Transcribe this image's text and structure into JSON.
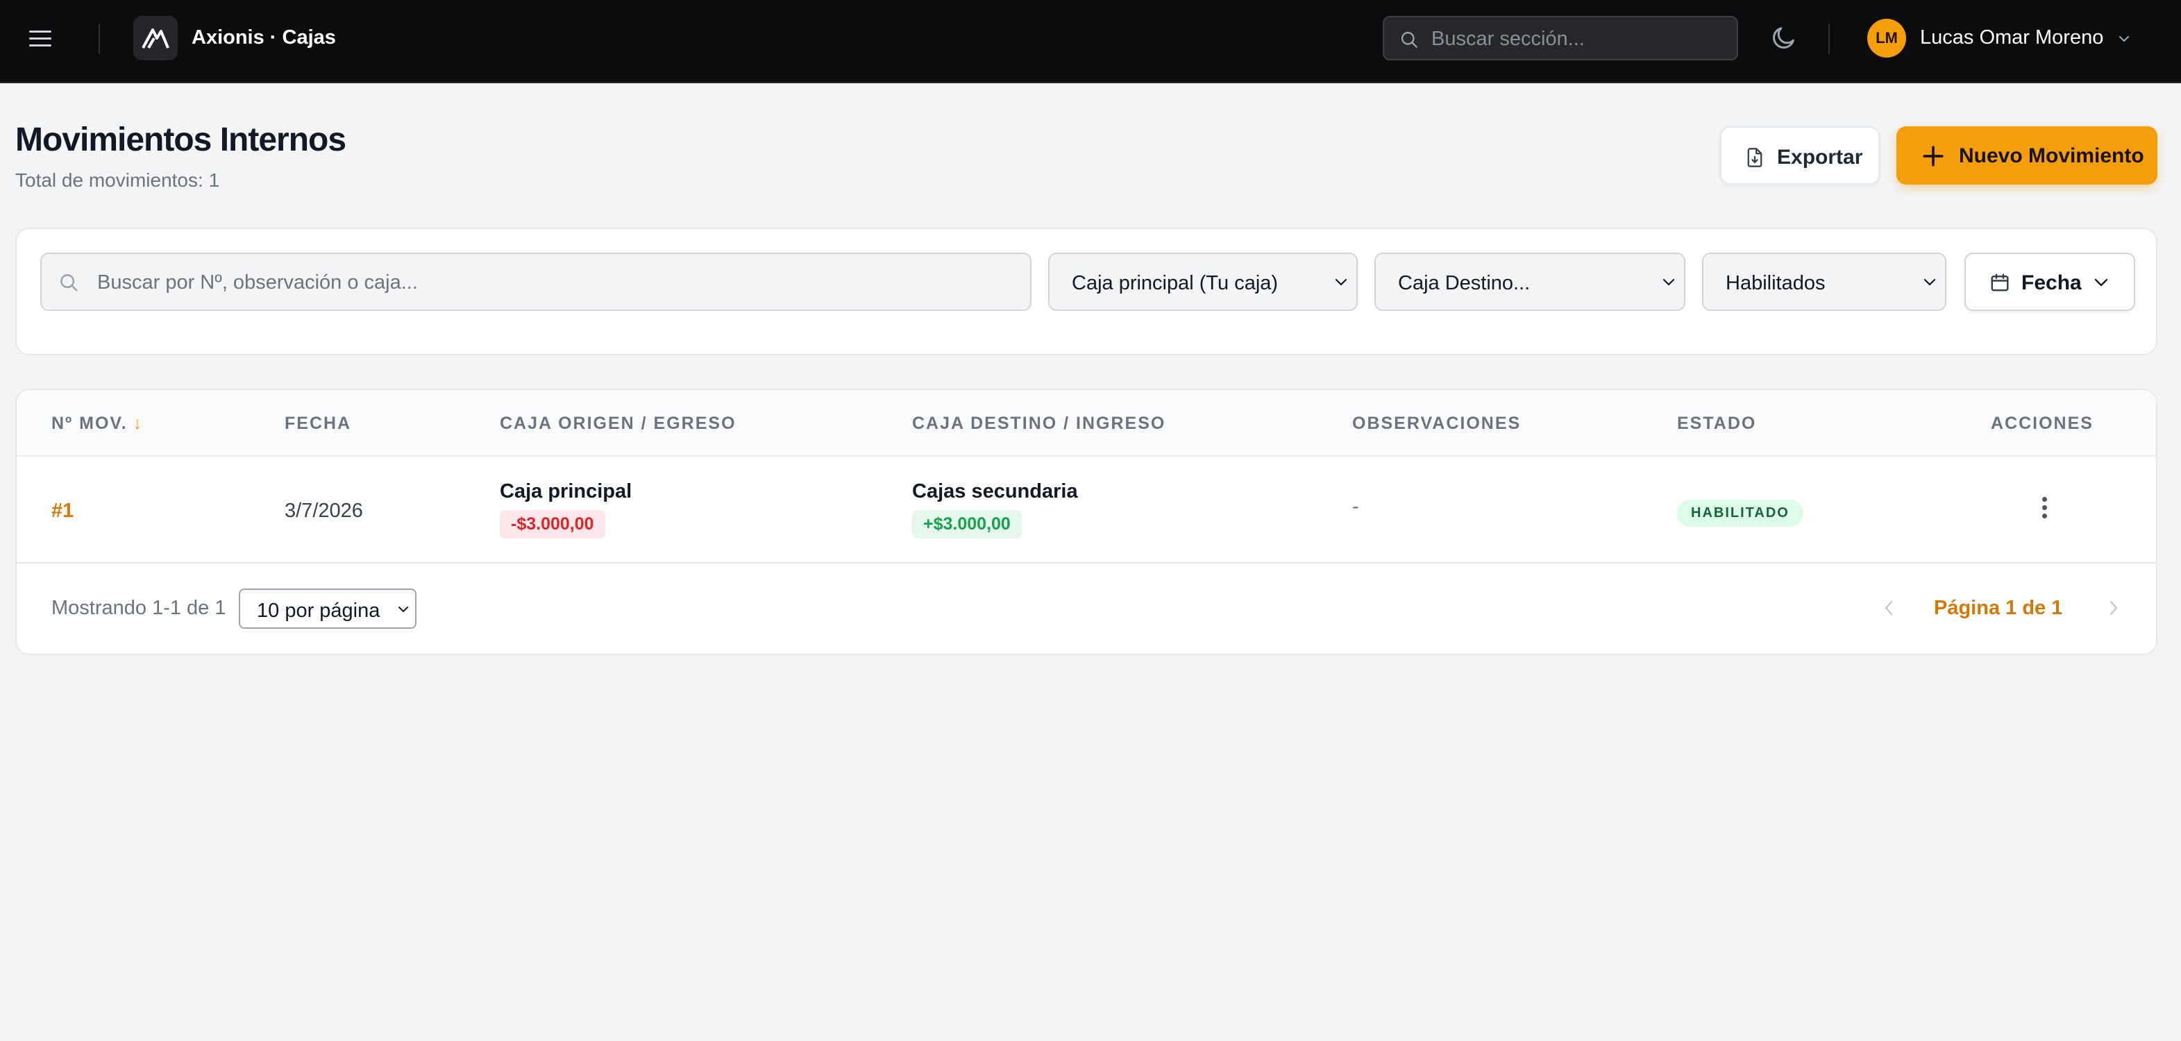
{
  "header": {
    "app_title": "Axionis · Cajas",
    "search_placeholder": "Buscar sección...",
    "user_initials": "LM",
    "user_name": "Lucas Omar Moreno"
  },
  "page": {
    "title": "Movimientos Internos",
    "subtitle": "Total de movimientos: 1",
    "export_label": "Exportar",
    "new_label": "Nuevo Movimiento"
  },
  "filters": {
    "search_placeholder": "Buscar por Nº, observación o caja...",
    "origin_select": "Caja principal (Tu caja)",
    "dest_select": "Caja Destino...",
    "status_select": "Habilitados",
    "date_label": "Fecha"
  },
  "table": {
    "columns": [
      "Nº MOV.",
      "FECHA",
      "CAJA ORIGEN / EGRESO",
      "CAJA DESTINO / INGRESO",
      "OBSERVACIONES",
      "ESTADO",
      "ACCIONES"
    ],
    "sort_indicator": "↓",
    "rows": [
      {
        "number": "#1",
        "date": "3/7/2026",
        "origin_name": "Caja principal",
        "origin_amount": "-$3.000,00",
        "dest_name": "Cajas secundaria",
        "dest_amount": "+$3.000,00",
        "observations": "-",
        "status": "HABILITADO"
      }
    ]
  },
  "footer": {
    "showing": "Mostrando 1-1 de 1",
    "per_page": "10 por página",
    "page_label": "Página 1 de 1"
  },
  "colors": {
    "accent": "#f59e0b",
    "accent_text": "#d97706",
    "topbar": "#0b0c0e",
    "negative": "#dc2626",
    "positive": "#16a34a"
  },
  "icons": [
    "menu-icon",
    "logo-icon",
    "search-icon",
    "moon-icon",
    "chevron-down-icon",
    "file-export-icon",
    "plus-icon",
    "calendar-icon",
    "sort-down-icon",
    "more-vertical-icon",
    "chevron-left-icon",
    "chevron-right-icon"
  ]
}
